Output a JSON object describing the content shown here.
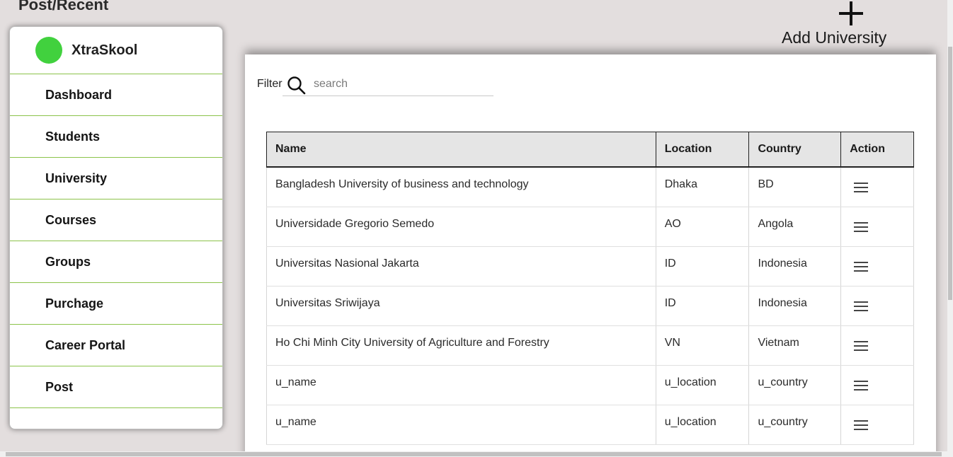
{
  "page": {
    "title": "Post/Recent"
  },
  "sidebar": {
    "brand": "XtraSkool",
    "brand_color": "#41d13e",
    "divider_color": "#8bc34a",
    "items": [
      {
        "label": "Dashboard"
      },
      {
        "label": "Students"
      },
      {
        "label": "University"
      },
      {
        "label": "Courses"
      },
      {
        "label": "Groups"
      },
      {
        "label": "Purchage"
      },
      {
        "label": "Career Portal"
      },
      {
        "label": "Post"
      }
    ]
  },
  "add_university": {
    "label": "Add University",
    "icon": "plus-icon"
  },
  "filter": {
    "label": "Filter",
    "placeholder": "search",
    "value": "",
    "icon": "search-icon"
  },
  "table": {
    "headers": {
      "name": "Name",
      "location": "Location",
      "country": "Country",
      "action": "Action"
    },
    "rows": [
      {
        "name": "Bangladesh University of business and technology",
        "location": "Dhaka",
        "country": "BD"
      },
      {
        "name": "Universidade Gregorio Semedo",
        "location": "AO",
        "country": "Angola"
      },
      {
        "name": "Universitas Nasional Jakarta",
        "location": "ID",
        "country": "Indonesia"
      },
      {
        "name": "Universitas Sriwijaya",
        "location": "ID",
        "country": "Indonesia"
      },
      {
        "name": "Ho Chi Minh City University of Agriculture and Forestry",
        "location": "VN",
        "country": "Vietnam"
      },
      {
        "name": "u_name",
        "location": "u_location",
        "country": "u_country"
      },
      {
        "name": "u_name",
        "location": "u_location",
        "country": "u_country"
      }
    ],
    "action_icon": "menu-icon"
  }
}
